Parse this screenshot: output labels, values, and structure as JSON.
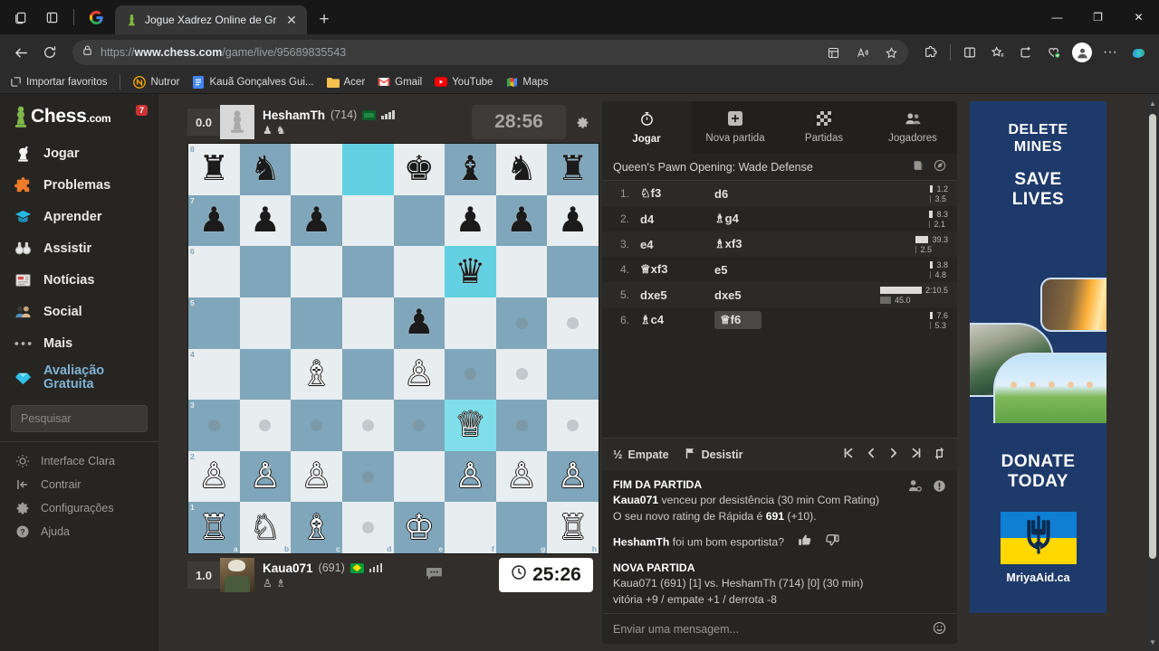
{
  "browser": {
    "tab": {
      "title": "Jogue Xadrez Online de Graça co",
      "favicon": "chess-pawn-icon",
      "close": "✕"
    },
    "newtab_label": "+",
    "window": {
      "minimize": "—",
      "maximize": "❐",
      "close": "✕"
    },
    "url_prefix": "https://",
    "url_bold": "www.chess.com",
    "url_rest": "/game/live/95689835543",
    "toolbar_icons": [
      "tab-actions-icon",
      "vertical-tabs-icon",
      "google-icon"
    ],
    "nav_icons": [
      "back-arrow-icon",
      "reload-icon",
      "lock-icon"
    ],
    "right_icons": [
      "collections-icon",
      "read-aloud-icon",
      "favorite-star-icon",
      "extensions-icon",
      "split-screen-icon",
      "favorites-bar-icon",
      "collections-add-icon",
      "browser-essentials-icon",
      "profile-avatar-icon",
      "settings-more-icon",
      "copilot-icon"
    ],
    "bookmarks": [
      {
        "label": "Importar favoritos",
        "icon": "import-favorites-icon"
      },
      {
        "label": "Nutror",
        "icon": "nutror-icon"
      },
      {
        "label": "Kauã Gonçalves Gui...",
        "icon": "docs-icon"
      },
      {
        "label": "Acer",
        "icon": "folder-icon"
      },
      {
        "label": "Gmail",
        "icon": "gmail-icon"
      },
      {
        "label": "YouTube",
        "icon": "youtube-icon"
      },
      {
        "label": "Maps",
        "icon": "maps-icon"
      }
    ]
  },
  "sidebar": {
    "logo": "Chess",
    "logo_suffix": ".com",
    "badge": "7",
    "items": [
      {
        "label": "Jogar",
        "icon": "play-pawn-icon"
      },
      {
        "label": "Problemas",
        "icon": "puzzle-icon"
      },
      {
        "label": "Aprender",
        "icon": "graduation-cap-icon"
      },
      {
        "label": "Assistir",
        "icon": "binoculars-icon"
      },
      {
        "label": "Notícias",
        "icon": "newspaper-icon"
      },
      {
        "label": "Social",
        "icon": "people-icon"
      },
      {
        "label": "Mais",
        "icon": "ellipsis-icon"
      }
    ],
    "promo_line1": "Avaliação",
    "promo_line2": "Gratuita",
    "promo_icon": "diamond-icon",
    "search_placeholder": "Pesquisar",
    "mini_items": [
      {
        "label": "Interface Clara",
        "icon": "sun-icon"
      },
      {
        "label": "Contrair",
        "icon": "collapse-icon"
      },
      {
        "label": "Configurações",
        "icon": "gear-icon"
      },
      {
        "label": "Ajuda",
        "icon": "help-circle-icon"
      }
    ]
  },
  "players": {
    "top": {
      "eval": "0.0",
      "name": "HeshamTh",
      "rating": "(714)",
      "flag": "sa",
      "clock": "28:56",
      "clock_active": false,
      "captured": [
        "pawn",
        "knight"
      ],
      "avatar": "default-pawn-avatar"
    },
    "bottom": {
      "eval": "1.0",
      "name": "Kaua071",
      "rating": "(691)",
      "flag": "br",
      "clock": "25:26",
      "clock_active": true,
      "clock_icon": "clock-icon",
      "captured": [
        "pawn",
        "bishop"
      ],
      "avatar": "user-photo-avatar"
    },
    "board_settings_icon": "gear-icon",
    "chat_bubble_icon": "chat-bubble-icon"
  },
  "board": {
    "files": [
      "a",
      "b",
      "c",
      "d",
      "e",
      "f",
      "g",
      "h"
    ],
    "ranks": [
      "8",
      "7",
      "6",
      "5",
      "4",
      "3",
      "2",
      "1"
    ],
    "highlighted": [
      "d8",
      "f6",
      "f3"
    ],
    "dots": [
      "g5",
      "a3",
      "b3",
      "c3",
      "d3",
      "e3",
      "g3",
      "h3",
      "f4",
      "g4",
      "d2",
      "d1",
      "h5"
    ],
    "position": [
      [
        "r",
        "n",
        "",
        "",
        "k",
        "b",
        "n",
        "r"
      ],
      [
        "p",
        "p",
        "p",
        "",
        "",
        "p",
        "p",
        "p"
      ],
      [
        "",
        "",
        "",
        "",
        "",
        "q",
        "",
        ""
      ],
      [
        "",
        "",
        "",
        "",
        "p",
        "",
        "",
        ""
      ],
      [
        "",
        "",
        "B",
        "",
        "P",
        "",
        "",
        ""
      ],
      [
        "",
        "",
        "",
        "",
        "",
        "Q",
        "",
        ""
      ],
      [
        "P",
        "P",
        "P",
        "",
        "",
        "P",
        "P",
        "P"
      ],
      [
        "R",
        "N",
        "B",
        "",
        "K",
        "",
        "",
        "R"
      ]
    ]
  },
  "gamepanel": {
    "tabs": [
      {
        "label": "Jogar",
        "icon": "timer-icon",
        "active": true
      },
      {
        "label": "Nova partida",
        "icon": "plus-square-icon",
        "active": false
      },
      {
        "label": "Partidas",
        "icon": "board-grid-icon",
        "active": false
      },
      {
        "label": "Jogadores",
        "icon": "players-icon",
        "active": false
      }
    ],
    "opening": "Queen's Pawn Opening: Wade Defense",
    "opening_icons": [
      "book-icon",
      "explorer-icon"
    ],
    "moves": [
      {
        "num": "1.",
        "white": "♘f3",
        "black": "d6",
        "wtime": "1.2",
        "btime": "3.5",
        "wbar": 3,
        "bbar": 1,
        "sel": false
      },
      {
        "num": "2.",
        "white": "d4",
        "black": "♗g4",
        "wtime": "8.3",
        "btime": "2.1",
        "wbar": 4,
        "bbar": 1,
        "sel": false
      },
      {
        "num": "3.",
        "white": "e4",
        "black": "♗xf3",
        "wtime": "39.3",
        "btime": "2.5",
        "wbar": 14,
        "bbar": 1,
        "sel": false
      },
      {
        "num": "4.",
        "white": "♕xf3",
        "black": "e5",
        "wtime": "3.8",
        "btime": "4.8",
        "wbar": 3,
        "bbar": 1,
        "sel": false
      },
      {
        "num": "5.",
        "white": "dxe5",
        "black": "dxe5",
        "wtime": "2:10.5",
        "btime": "45.0",
        "wbar": 46,
        "bbar": 12,
        "sel": false
      },
      {
        "num": "6.",
        "white": "♗c4",
        "black": "♕f6",
        "wtime": "7.6",
        "btime": "5.3",
        "wbar": 3,
        "bbar": 1,
        "sel": true
      }
    ],
    "actions": [
      {
        "label": "Empate",
        "icon": "half-point-icon"
      },
      {
        "label": "Desistir",
        "icon": "white-flag-icon"
      }
    ],
    "nav_buttons": [
      "first-move-icon",
      "prev-move-icon",
      "next-move-icon",
      "last-move-icon",
      "flip-board-icon"
    ],
    "chat": {
      "end_title": "FIM DA PARTIDA",
      "end_line1_name": "Kaua071",
      "end_line1_rest": " venceu por desistência (30 min Com Rating)",
      "end_line2_pre": "O seu novo rating de Rápida é ",
      "end_line2_rating": "691",
      "end_line2_post": " (+10).",
      "end_icons": [
        "add-friend-icon",
        "info-icon"
      ],
      "sport_question_name": "HeshamTh",
      "sport_question_rest": " foi um bom esportista?",
      "thumbs": [
        "thumbs-up-icon",
        "thumbs-down-icon"
      ],
      "new_title": "NOVA PARTIDA",
      "new_line1": "Kaua071 (691) [1] vs. HeshamTh (714) [0] (30 min)",
      "new_line2": "vitória +9 / empate +1 / derrota -8",
      "input_placeholder": "Enviar uma mensagem...",
      "emoji_icon": "smiley-icon"
    }
  },
  "ad": {
    "line1": "DELETE",
    "line2": "MINES",
    "line3": "SAVE",
    "line4": "LIVES",
    "cta1": "DONATE",
    "cta2": "TODAY",
    "url": "MriyaAid.ca",
    "flag": "ukraine-flag",
    "trident": "⚜"
  },
  "scrollbar": {
    "up": "▲",
    "down": "▼"
  }
}
